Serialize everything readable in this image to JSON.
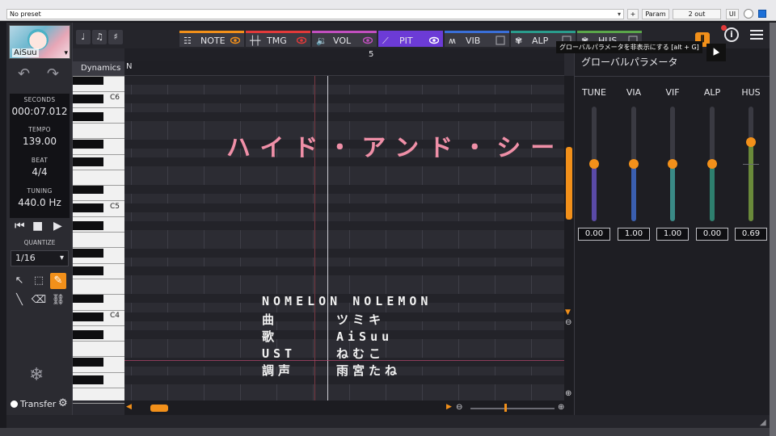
{
  "host": {
    "preset": "No preset",
    "param_label": "Param",
    "out_label": "2 out",
    "ui_label": "UI",
    "plus_label": "+"
  },
  "sidebar": {
    "avatar_name": "AiSuu",
    "seconds_label": "SECONDS",
    "seconds_value": "000:07.012",
    "tempo_label": "TEMPO",
    "tempo_value": "139.00",
    "beat_label": "BEAT",
    "beat_value": "4/4",
    "tuning_label": "TUNING",
    "tuning_value": "440.0 Hz",
    "quantize_label": "QUANTIZE",
    "quantize_value": "1/16",
    "transfer_label": "Transfer"
  },
  "tabs": [
    {
      "label": "NOTE",
      "color": "#f2901a"
    },
    {
      "label": "TMG",
      "color": "#e23a3a"
    },
    {
      "label": "VOL",
      "color": "#c14fbf"
    },
    {
      "label": "PIT",
      "color": "#6c3bd6"
    },
    {
      "label": "VIB",
      "color": "#3a6fd8"
    },
    {
      "label": "ALP",
      "color": "#2a9c8c"
    },
    {
      "label": "HUS",
      "color": "#5aa64a"
    }
  ],
  "tooltip": "グローバルパラメータを非表示にする [alt + G]",
  "editor": {
    "dynamics_label": "Dynamics",
    "dynamics_value": "N",
    "ruler_measure": "5",
    "key_labels": [
      "C6",
      "C5",
      "C4"
    ],
    "overlay_title": "ハイド・アンド・シーク",
    "credits": [
      {
        "k": "NOMELON NOLEMON",
        "v": ""
      },
      {
        "k": "曲",
        "v": "ツミキ"
      },
      {
        "k": "歌",
        "v": "AiSuu"
      },
      {
        "k": "UST",
        "v": "ねむこ"
      },
      {
        "k": "調声",
        "v": "雨宮たね"
      }
    ]
  },
  "global_params": {
    "title": "グローバルパラメータ",
    "sliders": [
      {
        "label": "TUNE",
        "value": "0.00",
        "color": "#5a4aa6"
      },
      {
        "label": "VIA",
        "value": "1.00",
        "color": "#3a5fb0"
      },
      {
        "label": "VIF",
        "value": "1.00",
        "color": "#3a8a86"
      },
      {
        "label": "ALP",
        "value": "0.00",
        "color": "#2e7f6e"
      },
      {
        "label": "HUS",
        "value": "0.69",
        "color": "#6a8a3a"
      }
    ]
  }
}
